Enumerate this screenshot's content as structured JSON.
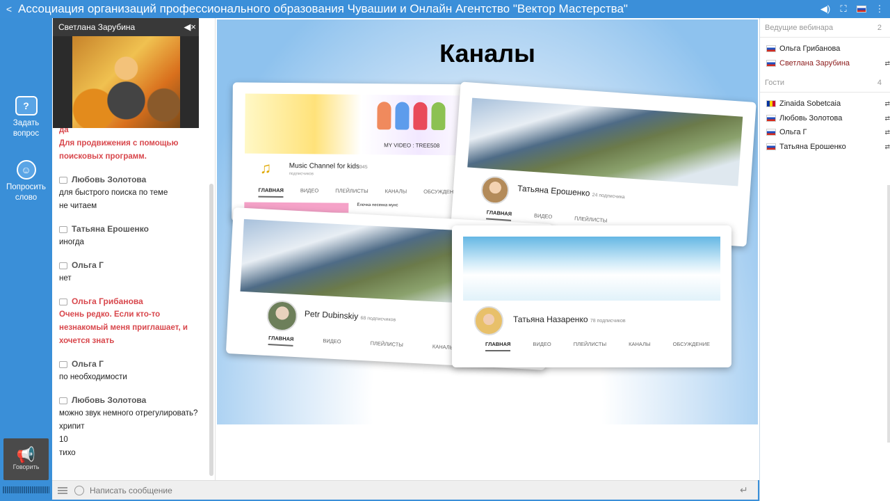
{
  "titlebar": {
    "title": "Ассоциация организаций профессионального образования Чувашии и Онлайн Агентство \"Вектор Мастерства\""
  },
  "leftbar": {
    "ask_label": "Задать вопрос",
    "ask_glyph": "?",
    "request_label": "Попросить слово",
    "request_glyph": "☺",
    "speak_label": "Говорить"
  },
  "video": {
    "name": "Светлана Зарубина"
  },
  "chat": {
    "messages": [
      {
        "author": "",
        "host": true,
        "lines": [
          "да",
          "Для продвижения с помощью",
          "поисковых программ."
        ]
      },
      {
        "author": "Любовь Золотова",
        "host": false,
        "lines": [
          "для быстрого поиска по теме",
          "не читаем"
        ]
      },
      {
        "author": "Татьяна Ерошенко",
        "host": false,
        "lines": [
          "иногда"
        ]
      },
      {
        "author": "Ольга Г",
        "host": false,
        "lines": [
          "нет"
        ]
      },
      {
        "author": "Ольга Грибанова",
        "host": true,
        "lines": [
          "Очень редко. Если кто-то",
          "незнакомый меня приглашает, и",
          "хочется знать"
        ]
      },
      {
        "author": "Ольга Г",
        "host": false,
        "lines": [
          "по необходимости"
        ]
      },
      {
        "author": "Любовь Золотова",
        "host": false,
        "lines": [
          "можно звук немного отрегулировать?",
          "хрипит",
          "10",
          "тихо"
        ]
      }
    ],
    "input_placeholder": "Написать сообщение"
  },
  "slide": {
    "title": "Каналы",
    "cards": [
      {
        "name": "Music Channel for kids",
        "subs": "945",
        "sub_label": "подписчиков",
        "banner_text": "MY VIDEO : TREE508",
        "video_title": "Ёлочка песенка мунс",
        "tabs": [
          "ГЛАВНАЯ",
          "ВИДЕО",
          "ПЛЕЙЛИСТЫ",
          "КАНАЛЫ",
          "ОБСУЖДЕНИЕ"
        ]
      },
      {
        "name": "Татьяна Ерошенко",
        "subs": "24 подписчика",
        "tabs": [
          "ГЛАВНАЯ",
          "ВИДЕО",
          "ПЛЕЙЛИСТЫ"
        ]
      },
      {
        "name": "Petr Dubinskiy",
        "subs": "68 подписчиков",
        "tabs": [
          "ГЛАВНАЯ",
          "ВИДЕО",
          "ПЛЕЙЛИСТЫ",
          "КАНАЛЫ"
        ]
      },
      {
        "name": "Татьяна Назаренко",
        "subs": "78 подписчиков",
        "tabs": [
          "ГЛАВНАЯ",
          "ВИДЕО",
          "ПЛЕЙЛИСТЫ",
          "КАНАЛЫ",
          "ОБСУЖДЕНИЕ"
        ]
      }
    ]
  },
  "participants": {
    "hosts_label": "Ведущие вебинара",
    "hosts_count": "2",
    "hosts": [
      {
        "name": "Ольга Грибанова",
        "active": false
      },
      {
        "name": "Светлана Зарубина",
        "active": true
      }
    ],
    "guests_label": "Гости",
    "guests_count": "4",
    "guests": [
      {
        "name": "Zinaida Sobetcaia",
        "flag": "md"
      },
      {
        "name": "Любовь Золотова",
        "flag": "ru"
      },
      {
        "name": "Ольга Г",
        "flag": "ru"
      },
      {
        "name": "Татьяна Ерошенко",
        "flag": "ru"
      }
    ]
  },
  "icons": [
    "share-icon",
    "volume-icon",
    "fullscreen-icon",
    "flag-ru-icon",
    "question-bubble-icon",
    "raise-hand-icon",
    "megaphone-icon",
    "mute-icon",
    "menu-icon",
    "smile-icon",
    "enter-icon"
  ]
}
